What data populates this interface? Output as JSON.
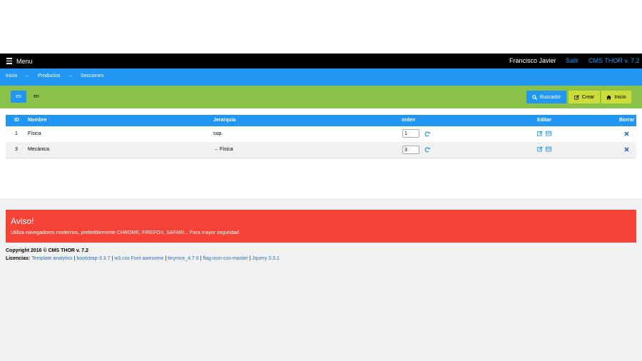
{
  "topbar": {
    "menu_label": "Menu",
    "user": "Francisco Javier",
    "logout": "Salir",
    "cms": "CMS THOR v. 7.2"
  },
  "breadcrumb": {
    "items": [
      "Inicio",
      "Productos",
      "Secciones"
    ],
    "separator": "→"
  },
  "languages": {
    "active": "es",
    "other": "en"
  },
  "actions": {
    "search": "Buscador",
    "create": "Crear",
    "home": "Inicio"
  },
  "table": {
    "headers": [
      "ID",
      "Nombre",
      "Jerarquía",
      "orden",
      "Editar",
      "Borrar"
    ],
    "rows": [
      {
        "id": "1",
        "name": "Física",
        "hierarchy": "sup.",
        "order": "1"
      },
      {
        "id": "3",
        "name": "Mecánica",
        "hierarchy": "→ Física",
        "order": "3"
      }
    ]
  },
  "notice": {
    "title": "Aviso!",
    "message": "Utiliza navegadores modernos, preferiblemente CHROME, FIREFOX, SAFARI... Para mayor seguridad"
  },
  "footer": {
    "copyright": "Copyright 2016 © CMS THOR v. 7.2",
    "licenses_label": "Licencias:",
    "licenses": [
      "Template analytics",
      "bootstrap-3.3.7",
      "w3.css Font awesome",
      "tinymce_4.7.6",
      "flag-icon-css-master",
      "Jquery 3.3.1"
    ]
  },
  "colors": {
    "primary": "#2196f3",
    "green_bar": "#8bc34a",
    "lime": "#cddc39",
    "alert": "#f44336",
    "black": "#000000"
  }
}
